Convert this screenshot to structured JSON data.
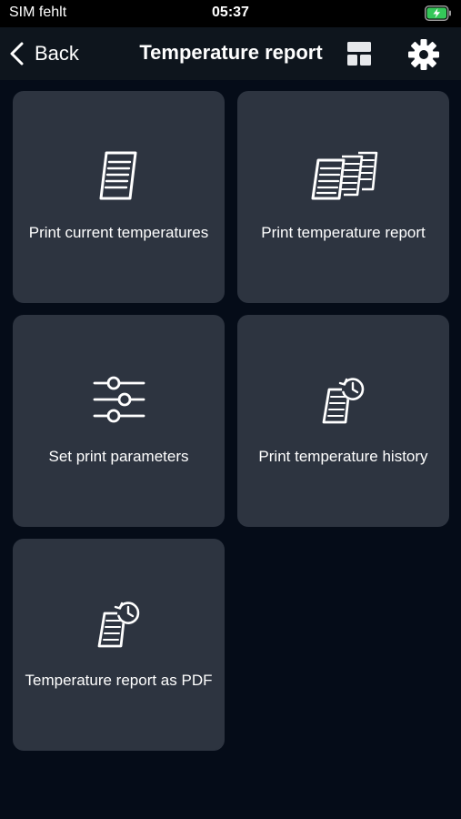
{
  "status_bar": {
    "carrier": "SIM fehlt",
    "time": "05:37",
    "battery_icon": "battery-charging-icon",
    "battery_color": "#35c759"
  },
  "nav": {
    "back_label": "Back",
    "title": "Temperature report",
    "layout_icon": "layout-icon",
    "settings_icon": "gear-icon"
  },
  "tiles": [
    {
      "label": "Print current temperatures",
      "icon": "document-icon"
    },
    {
      "label": "Print temperature report",
      "icon": "documents-stack-icon"
    },
    {
      "label": "Set print parameters",
      "icon": "sliders-icon"
    },
    {
      "label": "Print temperature history",
      "icon": "document-history-icon"
    },
    {
      "label": "Temperature report as PDF",
      "icon": "document-history-icon"
    }
  ],
  "colors": {
    "background": "#050c18",
    "navbar": "#0e151d",
    "tile": "#2d3440",
    "text": "#ffffff"
  }
}
